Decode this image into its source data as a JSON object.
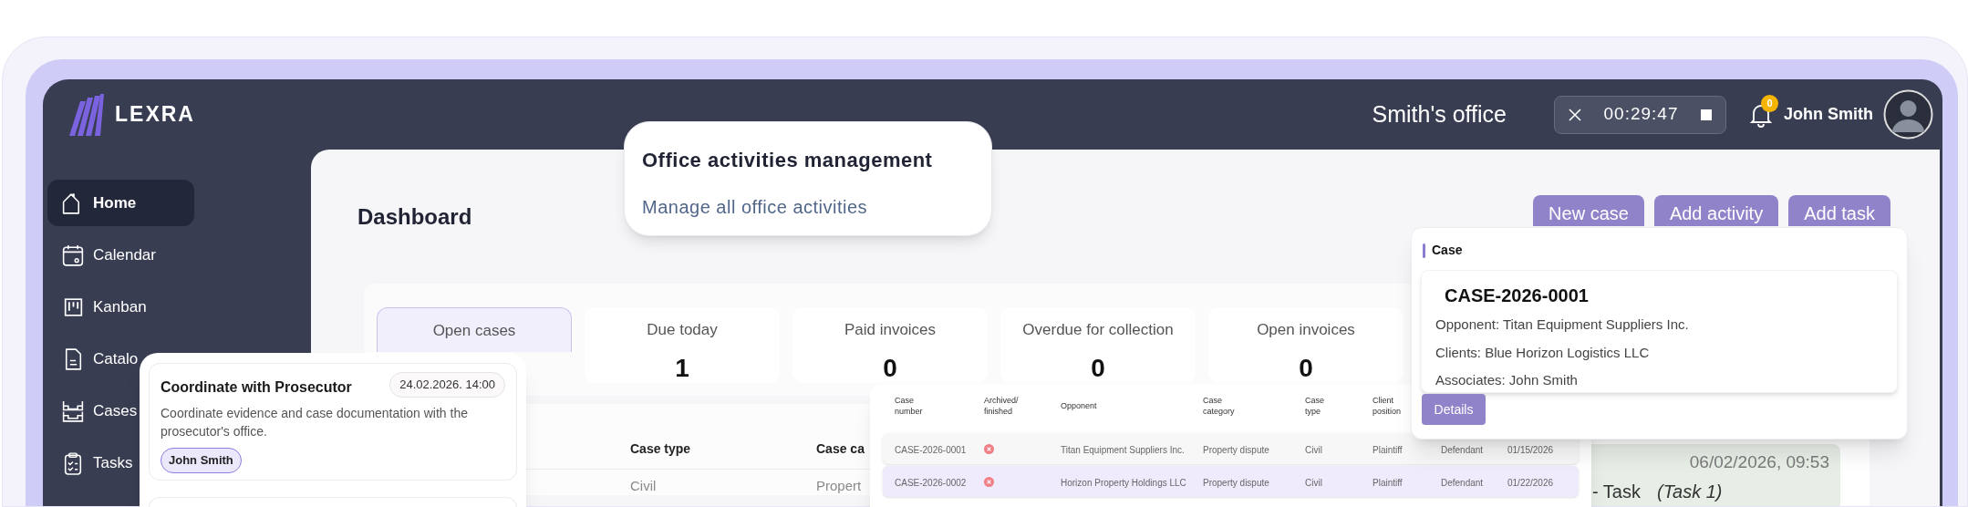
{
  "header": {
    "logo_text": "LEXRA",
    "office": "Smith's office",
    "timer": {
      "time": "00:29:47"
    },
    "notifications": {
      "count": "0"
    },
    "user": {
      "name": "John Smith"
    }
  },
  "sidebar": {
    "items": [
      {
        "label": "Home",
        "selected": true
      },
      {
        "label": "Calendar",
        "selected": false
      },
      {
        "label": "Kanban",
        "selected": false
      },
      {
        "label": "Catalo",
        "selected": false
      },
      {
        "label": "Cases",
        "selected": false
      },
      {
        "label": "Tasks",
        "selected": false
      }
    ]
  },
  "dashboard": {
    "title": "Dashboard",
    "actions": [
      "New case",
      "Add activity",
      "Add task"
    ],
    "stats": [
      {
        "label": "Open cases",
        "selected": true
      },
      {
        "label": "Due today",
        "value": "1",
        "selected": false
      },
      {
        "label": "Paid invoices",
        "value": "0",
        "selected": false
      },
      {
        "label": "Overdue for collection",
        "value": "0",
        "selected": false
      },
      {
        "label": "Open invoices",
        "value": "0",
        "selected": false
      }
    ],
    "table": {
      "columns": [
        "Case type",
        "Case ca"
      ],
      "rows": [
        [
          "Civil",
          "Propert"
        ]
      ]
    },
    "activity": {
      "time": "06/02/2026, 09:53",
      "title": "- Task",
      "detail": "(Task 1)"
    }
  },
  "feature_callout": {
    "title": "Office activities management",
    "subtitle": "Manage all office activities"
  },
  "task_list": {
    "tasks": [
      {
        "title": "Coordinate with Prosecutor",
        "due": "24.02.2026. 14:00",
        "description": "Coordinate evidence and case documentation with the prosecutor's office.",
        "assignee": "John Smith"
      }
    ]
  },
  "case_table": {
    "columns": [
      "Case number",
      "Archived/ finished",
      "Opponent",
      "Case category",
      "Case type",
      "Client position"
    ],
    "rows": [
      {
        "archived": false,
        "selected": false,
        "cells": [
          "CASE-2026-0001",
          "",
          "Titan Equipment Suppliers Inc.",
          "Property dispute",
          "Civil",
          "Plaintiff",
          "Defendant",
          "01/15/2026"
        ]
      },
      {
        "archived": false,
        "selected": true,
        "cells": [
          "CASE-2026-0002",
          "",
          "Horizon Property Holdings LLC",
          "Property dispute",
          "Civil",
          "Plaintiff",
          "Defendant",
          "01/22/2026"
        ]
      }
    ]
  },
  "case_preview": {
    "heading": "Case",
    "number": "CASE-2026-0001",
    "lines": [
      "Opponent: Titan Equipment Suppliers Inc.",
      "Clients: Blue Horizon Logistics LLC",
      "Associates: John Smith"
    ],
    "button": "Details"
  }
}
